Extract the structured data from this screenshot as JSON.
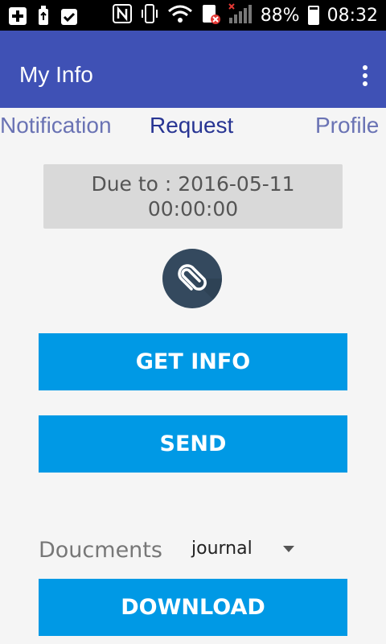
{
  "status_bar": {
    "battery_percent": "88%",
    "time": "08:32",
    "icons": [
      "add-box-icon",
      "usb-icon",
      "clipboard-check-icon",
      "nfc-icon",
      "vibrate-icon",
      "wifi-icon",
      "sim-error-icon",
      "signal-icon",
      "battery-charging-icon"
    ]
  },
  "app_bar": {
    "title": "My Info",
    "overflow_icon": "more-vert-icon"
  },
  "tabs": [
    {
      "label": "Notification",
      "selected": false
    },
    {
      "label": "Request",
      "selected": true
    },
    {
      "label": "Profile",
      "selected": false
    }
  ],
  "due": {
    "line1": "Due to : 2016-05-11",
    "line2": "00:00:00"
  },
  "attach_icon": "paperclip-icon",
  "buttons": {
    "get_info": "GET INFO",
    "send": "SEND",
    "download": "DOWNLOAD"
  },
  "documents": {
    "label": "Doucments",
    "selected": "journal"
  },
  "colors": {
    "app_bar": "#3f51b5",
    "button": "#0099e5",
    "tab_selected": "#283593",
    "tab_unselected": "#6a73b4",
    "attach_circle": "#34495e"
  }
}
